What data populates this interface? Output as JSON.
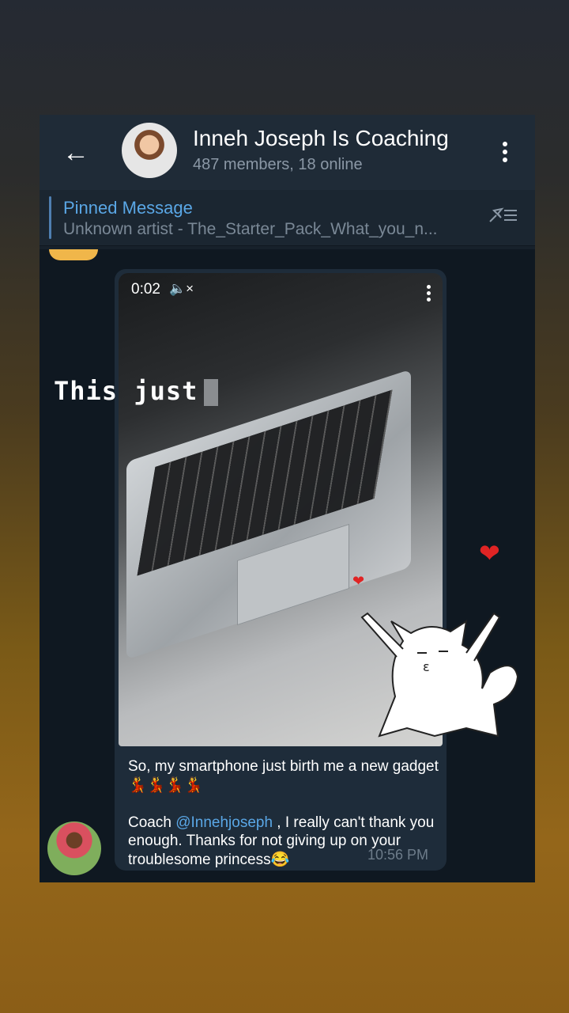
{
  "header": {
    "title": "Inneh Joseph Is Coaching",
    "subtitle": "487 members, 18 online"
  },
  "pinned": {
    "title": "Pinned Message",
    "text": "Unknown artist - The_Starter_Pack_What_you_n..."
  },
  "video": {
    "duration": "0:02",
    "mute_icon": "🔇"
  },
  "message": {
    "line1": "So, my smartphone just birth me a new gadget💃💃💃💃",
    "coach_prefix": "Coach ",
    "mention": "@Innehjoseph",
    "line2_rest": " , I really can't thank you enough. Thanks for not giving up on your troublesome princess😂",
    "time": "10:56 PM"
  },
  "overlay": {
    "caption": "This just"
  },
  "icons": {
    "back": "back-arrow-icon",
    "menu": "more-vertical-icon",
    "pin": "pin-list-icon",
    "heart": "heart-icon",
    "sticker": "cat-sticker-icon"
  },
  "colors": {
    "accent": "#5aa7e6",
    "heart": "#e02424"
  }
}
